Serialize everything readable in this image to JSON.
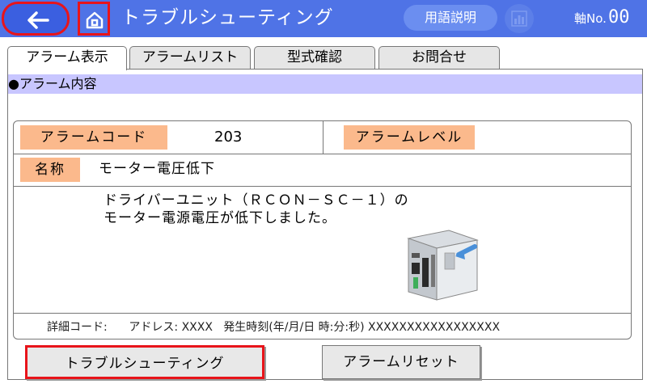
{
  "header": {
    "title": "トラブルシューティング",
    "glossary_label": "用語説明",
    "axis_label": "軸No.",
    "axis_number": "00",
    "icons": [
      "back-arrow-icon",
      "home-icon",
      "chart-icon"
    ]
  },
  "tabs": [
    {
      "label": "アラーム表示",
      "active": true
    },
    {
      "label": "アラームリスト",
      "active": false
    },
    {
      "label": "型式確認",
      "active": false
    },
    {
      "label": "お問合せ",
      "active": false
    }
  ],
  "section": {
    "title": "●アラーム内容"
  },
  "alarm": {
    "code_label": "アラームコード",
    "code_value": "203",
    "level_label": "アラームレベル",
    "level_value": "",
    "name_label": "名称",
    "name_value": "モーター電圧低下",
    "message": "ドライバーユニット（ＲＣＯＮ－ＳＣ－１）の\nモーター電源電圧が低下しました。",
    "detail_line": "詳細コード:      アドレス: XXXX   発生時刻(年/月/日 時:分:秒) XXXXXXXXXXXXXXXXX"
  },
  "buttons": {
    "troubleshoot": "トラブルシューティング",
    "reset": "アラームリセット"
  },
  "colors": {
    "header": "#4f73e6",
    "highlight_border": "#e8141a",
    "label_chip": "#fbb98c",
    "section_bar": "#c8c6ff"
  }
}
